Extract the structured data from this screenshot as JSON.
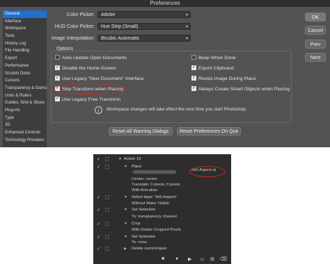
{
  "dialog": {
    "title": "Preferences",
    "sidebar": [
      "General",
      "Interface",
      "Workspace",
      "Tools",
      "History Log",
      "File Handling",
      "Export",
      "Performance",
      "Scratch Disks",
      "Cursors",
      "Transparency & Gamut",
      "Units & Rulers",
      "Guides, Grid & Slices",
      "Plug-ins",
      "Type",
      "3D",
      "Enhanced Controls",
      "Technology Previews"
    ],
    "color_picker": {
      "label": "Color Picker:",
      "value": "Adobe"
    },
    "hud_color_picker": {
      "label": "HUD Color Picker:",
      "value": "Hue Strip (Small)"
    },
    "image_interpolation": {
      "label": "Image Interpolation:",
      "value": "Bicubic Automatic"
    },
    "options_title": "Options",
    "options_left": [
      {
        "label": "Auto-Update Open Documents",
        "checked": false
      },
      {
        "label": "Disable the Home Screen",
        "checked": true
      },
      {
        "label": "Use Legacy \"New Document\" Interface",
        "checked": true
      },
      {
        "label": "Skip Transform when Placing",
        "checked": true
      },
      {
        "label": "Use Legacy Free Transform",
        "checked": true
      }
    ],
    "options_right": [
      {
        "label": "Beep When Done",
        "checked": false
      },
      {
        "label": "Export Clipboard",
        "checked": true
      },
      {
        "label": "Resize Image During Place",
        "checked": true
      },
      {
        "label": "Always Create Smart Objects when Placing",
        "checked": true
      }
    ],
    "info_text": "Workspace changes will take effect the next time you start Photoshop.",
    "reset_warnings": "Reset All Warning Dialogs",
    "reset_prefs": "Reset Preferences On Quit",
    "ok": "OK",
    "cancel": "Cancel",
    "prev": "Prev",
    "next": "Next"
  },
  "actions": {
    "action_name": "Action 19",
    "steps": [
      {
        "name": "Place",
        "details": [
          "Center: center",
          "Translate: 0 pixels, 0 pixels",
          "With Anti-alias"
        ],
        "file": "4x5-Aspect.ai"
      },
      {
        "name": "Select layer \"4x5-Aspect\"",
        "details": [
          "Without Make Visible"
        ]
      },
      {
        "name": "Set Selection",
        "details": [
          "To: transparency channel"
        ]
      },
      {
        "name": "Crop",
        "details": [
          "With Delete Cropped Pixels"
        ]
      },
      {
        "name": "Set Selection",
        "details": [
          "To: none"
        ]
      },
      {
        "name": "Delete current layer",
        "details": []
      }
    ],
    "check_glyph": "✓"
  },
  "colors": {
    "dialog_bg": "#535353",
    "sidebar_bg": "#3d3d3d",
    "selected": "#1f6fd1",
    "highlight_oval": "#d8261c",
    "panel_bg": "#2d2d2d"
  }
}
